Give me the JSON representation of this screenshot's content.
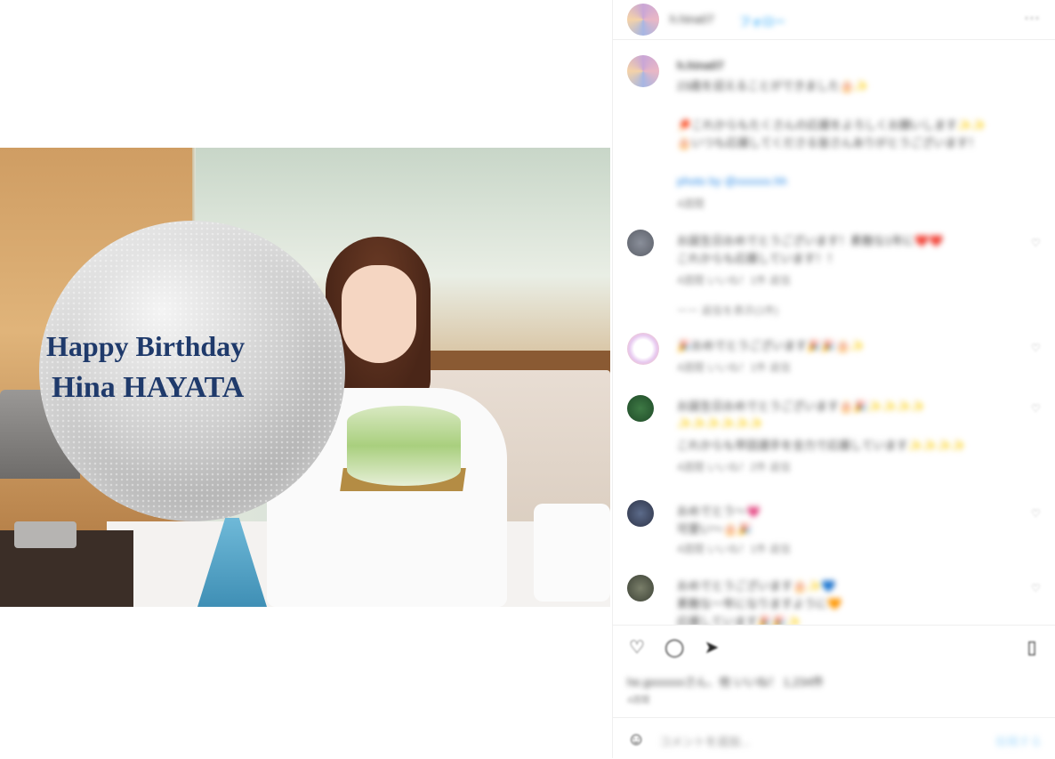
{
  "photo": {
    "balloon_line1": "Happy Birthday",
    "balloon_line2": "Hina HAYATA"
  },
  "header": {
    "username": "h.hina07",
    "follow_label": "フォロー",
    "more_icon": "more-horizontal-icon"
  },
  "caption": {
    "username": "h.hina07",
    "line1": "23歳を迎えることができました🎂✨",
    "line2": "🏓これからもたくさんの応援をよろしくお願いします✨✨",
    "line3": "🎂いつも応援してくださる皆さんありがとうございます！",
    "photo_credit": "photo by @xxxxxx.hh",
    "timestamp": "4週間"
  },
  "comments": [
    {
      "user": "hirx.........",
      "text": "お誕生日おめでとうございます！素敵な1年に❤️❤️",
      "text2": "これからも応援しています！！",
      "meta": "4週間  いいね！1件  返信"
    },
    {
      "user": "",
      "text": "ーー 返信を表示(1件)",
      "text2": "",
      "meta": ""
    },
    {
      "user": "xxx.x",
      "text": "🎉おめでとうございます🎉🎉🎂✨",
      "text2": "",
      "meta": "4週間  いいね！1件  返信"
    },
    {
      "user": "xxxx.xxx.xxx",
      "text": "お誕生日おめでとうございます🎂🎉✨✨✨✨",
      "text2": "✨✨✨✨✨✨",
      "text3": "これからも早田選手を全力で応援しています✨✨✨✨",
      "meta": "4週間  いいね！2件  返信"
    },
    {
      "user": "xxxxx.xx",
      "text": "おめでとう〜💗",
      "text2": "可愛い〜🎂🎉",
      "meta": "4週間  いいね！1件  返信"
    },
    {
      "user": "xxxxxxxx.xxx",
      "text": "おめでとうございます🎂✨💙",
      "text2": "素敵な一年になりますように🧡",
      "text3": "応援しています🎉🎉✨",
      "meta": ""
    }
  ],
  "actions": {
    "like_icon": "heart-icon",
    "comment_icon": "comment-icon",
    "share_icon": "send-icon",
    "save_icon": "bookmark-icon"
  },
  "likes_text": "he.gxxxxxxさん、他 いいね！ 1,234件",
  "date_text": "4週間",
  "add_comment": {
    "emoji_icon": "smiley-icon",
    "placeholder": "コメントを追加...",
    "post_label": "投稿する"
  }
}
